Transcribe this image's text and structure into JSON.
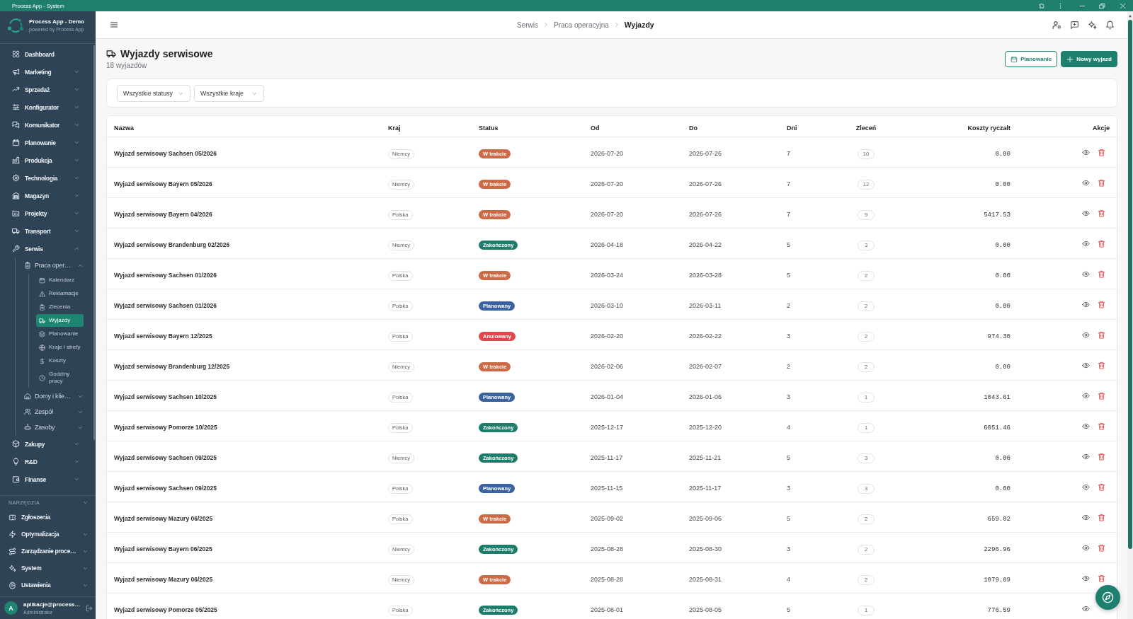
{
  "window": {
    "title": "Process App - System"
  },
  "sidebar": {
    "app_name": "Process App - Demo",
    "tagline": "powered by Process App",
    "items": [
      {
        "label": "Dashboard",
        "selected": false
      },
      {
        "label": "Marketing",
        "expanded": false,
        "selected": false
      },
      {
        "label": "Sprzedaż",
        "expanded": false,
        "selected": false
      },
      {
        "label": "Konfigurator",
        "expanded": false,
        "selected": false
      },
      {
        "label": "Komunikator",
        "expanded": false,
        "selected": false
      },
      {
        "label": "Planowanie",
        "expanded": false,
        "selected": false
      },
      {
        "label": "Produkcja",
        "expanded": false,
        "selected": false
      },
      {
        "label": "Technologia",
        "expanded": false,
        "selected": false
      },
      {
        "label": "Magazyn",
        "expanded": false,
        "selected": false
      },
      {
        "label": "Projekty",
        "expanded": false,
        "selected": false
      },
      {
        "label": "Transport",
        "expanded": false,
        "selected": false
      },
      {
        "label": "Serwis",
        "expanded": true,
        "selected": false,
        "children": [
          {
            "label": "Praca oper…",
            "expanded": true,
            "selected": false,
            "children": [
              {
                "label": "Kalendarz",
                "selected": false
              },
              {
                "label": "Reklamacje",
                "selected": false
              },
              {
                "label": "Zlecenia",
                "selected": false
              },
              {
                "label": "Wyjazdy",
                "selected": true
              },
              {
                "label": "Planowanie",
                "selected": false
              },
              {
                "label": "Kraje i strefy",
                "selected": false
              },
              {
                "label": "Koszty",
                "selected": false
              },
              {
                "label": "Godziny pracy",
                "selected": false
              }
            ]
          },
          {
            "label": "Domy i klie…",
            "expanded": false,
            "selected": false
          },
          {
            "label": "Zespół",
            "expanded": false,
            "selected": false
          },
          {
            "label": "Zasoby",
            "expanded": false,
            "selected": false
          }
        ]
      },
      {
        "label": "Zakupy",
        "expanded": false,
        "selected": false
      },
      {
        "label": "R&D",
        "expanded": false,
        "selected": false
      },
      {
        "label": "Finanse",
        "expanded": false,
        "selected": false
      }
    ],
    "tools": {
      "title": "NARZĘDZIA",
      "expanded": true,
      "items": [
        {
          "label": "Zgłoszenia",
          "selected": false
        },
        {
          "label": "Optymalizacja",
          "expanded": false,
          "selected": false
        },
        {
          "label": "Zarządzanie proce…",
          "expanded": false,
          "selected": false
        },
        {
          "label": "System",
          "expanded": false,
          "selected": false
        },
        {
          "label": "Ustawienia",
          "expanded": false,
          "selected": false
        }
      ]
    },
    "user": {
      "initial": "A",
      "email": "aplikacje@process…",
      "role": "Administrator"
    }
  },
  "breadcrumb": [
    {
      "label": "Serwis",
      "current": false
    },
    {
      "label": "Praca operacyjna",
      "current": false
    },
    {
      "label": "Wyjazdy",
      "current": true
    }
  ],
  "page": {
    "title": "Wyjazdy serwisowe",
    "subtitle": "18 wyjazdów",
    "buttons": [
      {
        "label": "Planowanie",
        "kind": "outline"
      },
      {
        "label": "Nowy wyjazd",
        "kind": "primary"
      }
    ]
  },
  "filters": [
    {
      "value": "Wszystkie statusy"
    },
    {
      "value": "Wszystkie kraje"
    }
  ],
  "table": {
    "columns": [
      "Nazwa",
      "Kraj",
      "Status",
      "Od",
      "Do",
      "Dni",
      "Zleceń",
      "Koszty ryczałt",
      "Akcje"
    ],
    "rows": [
      {
        "name": "Wyjazd serwisowy Sachsen 05/2026",
        "country": "Niemcy",
        "status": {
          "label": "W trakcie",
          "color": "#cb6a45"
        },
        "from": "2026-07-20",
        "to": "2026-07-26",
        "days": "7",
        "orders": "10",
        "cost": "0.00"
      },
      {
        "name": "Wyjazd serwisowy Bayern 05/2026",
        "country": "Niemcy",
        "status": {
          "label": "W trakcie",
          "color": "#cb6a45"
        },
        "from": "2026-07-20",
        "to": "2026-07-26",
        "days": "7",
        "orders": "12",
        "cost": "0.00"
      },
      {
        "name": "Wyjazd serwisowy Bayern 04/2026",
        "country": "Polska",
        "status": {
          "label": "W trakcie",
          "color": "#cb6a45"
        },
        "from": "2026-07-20",
        "to": "2026-07-26",
        "days": "7",
        "orders": "9",
        "cost": "5417.53"
      },
      {
        "name": "Wyjazd serwisowy Brandenburg 02/2026",
        "country": "Niemcy",
        "status": {
          "label": "Zakończony",
          "color": "#1e7d6a"
        },
        "from": "2026-04-18",
        "to": "2026-04-22",
        "days": "5",
        "orders": "3",
        "cost": "0.00"
      },
      {
        "name": "Wyjazd serwisowy Sachsen 01/2026",
        "country": "Polska",
        "status": {
          "label": "W trakcie",
          "color": "#cb6a45"
        },
        "from": "2026-03-24",
        "to": "2026-03-28",
        "days": "5",
        "orders": "2",
        "cost": "0.00"
      },
      {
        "name": "Wyjazd serwisowy Sachsen 01/2026",
        "country": "Polska",
        "status": {
          "label": "Planowany",
          "color": "#3b62a0"
        },
        "from": "2026-03-10",
        "to": "2026-03-11",
        "days": "2",
        "orders": "2",
        "cost": "0.00"
      },
      {
        "name": "Wyjazd serwisowy Bayern 12/2025",
        "country": "Polska",
        "status": {
          "label": "Anulowany",
          "color": "#e2464c"
        },
        "from": "2026-02-20",
        "to": "2026-02-22",
        "days": "3",
        "orders": "2",
        "cost": "974.30"
      },
      {
        "name": "Wyjazd serwisowy Brandenburg 12/2025",
        "country": "Niemcy",
        "status": {
          "label": "W trakcie",
          "color": "#cb6a45"
        },
        "from": "2026-02-06",
        "to": "2026-02-07",
        "days": "2",
        "orders": "2",
        "cost": "0.00"
      },
      {
        "name": "Wyjazd serwisowy Sachsen 10/2025",
        "country": "Polska",
        "status": {
          "label": "Planowany",
          "color": "#3b62a0"
        },
        "from": "2026-01-04",
        "to": "2026-01-06",
        "days": "3",
        "orders": "1",
        "cost": "1043.61"
      },
      {
        "name": "Wyjazd serwisowy Pomorze 10/2025",
        "country": "Polska",
        "status": {
          "label": "Zakończony",
          "color": "#1e7d6a"
        },
        "from": "2025-12-17",
        "to": "2025-12-20",
        "days": "4",
        "orders": "1",
        "cost": "6051.46"
      },
      {
        "name": "Wyjazd serwisowy Sachsen 09/2025",
        "country": "Niemcy",
        "status": {
          "label": "Zakończony",
          "color": "#1e7d6a"
        },
        "from": "2025-11-17",
        "to": "2025-11-21",
        "days": "5",
        "orders": "3",
        "cost": "0.00"
      },
      {
        "name": "Wyjazd serwisowy Sachsen 09/2025",
        "country": "Polska",
        "status": {
          "label": "Planowany",
          "color": "#3b62a0"
        },
        "from": "2025-11-15",
        "to": "2025-11-17",
        "days": "3",
        "orders": "3",
        "cost": "0.00"
      },
      {
        "name": "Wyjazd serwisowy Mazury 06/2025",
        "country": "Polska",
        "status": {
          "label": "W trakcie",
          "color": "#cb6a45"
        },
        "from": "2025-09-02",
        "to": "2025-09-06",
        "days": "5",
        "orders": "2",
        "cost": "659.02"
      },
      {
        "name": "Wyjazd serwisowy Bayern 06/2025",
        "country": "Niemcy",
        "status": {
          "label": "Zakończony",
          "color": "#1e7d6a"
        },
        "from": "2025-08-28",
        "to": "2025-08-30",
        "days": "3",
        "orders": "2",
        "cost": "2296.96"
      },
      {
        "name": "Wyjazd serwisowy Mazury 06/2025",
        "country": "Niemcy",
        "status": {
          "label": "W trakcie",
          "color": "#cb6a45"
        },
        "from": "2025-08-28",
        "to": "2025-08-31",
        "days": "4",
        "orders": "2",
        "cost": "1079.89"
      },
      {
        "name": "Wyjazd serwisowy Pomorze 05/2025",
        "country": "Polska",
        "status": {
          "label": "Zakończony",
          "color": "#1e7d6a"
        },
        "from": "2025-08-01",
        "to": "2025-08-05",
        "days": "5",
        "orders": "1",
        "cost": "776.59"
      }
    ]
  }
}
